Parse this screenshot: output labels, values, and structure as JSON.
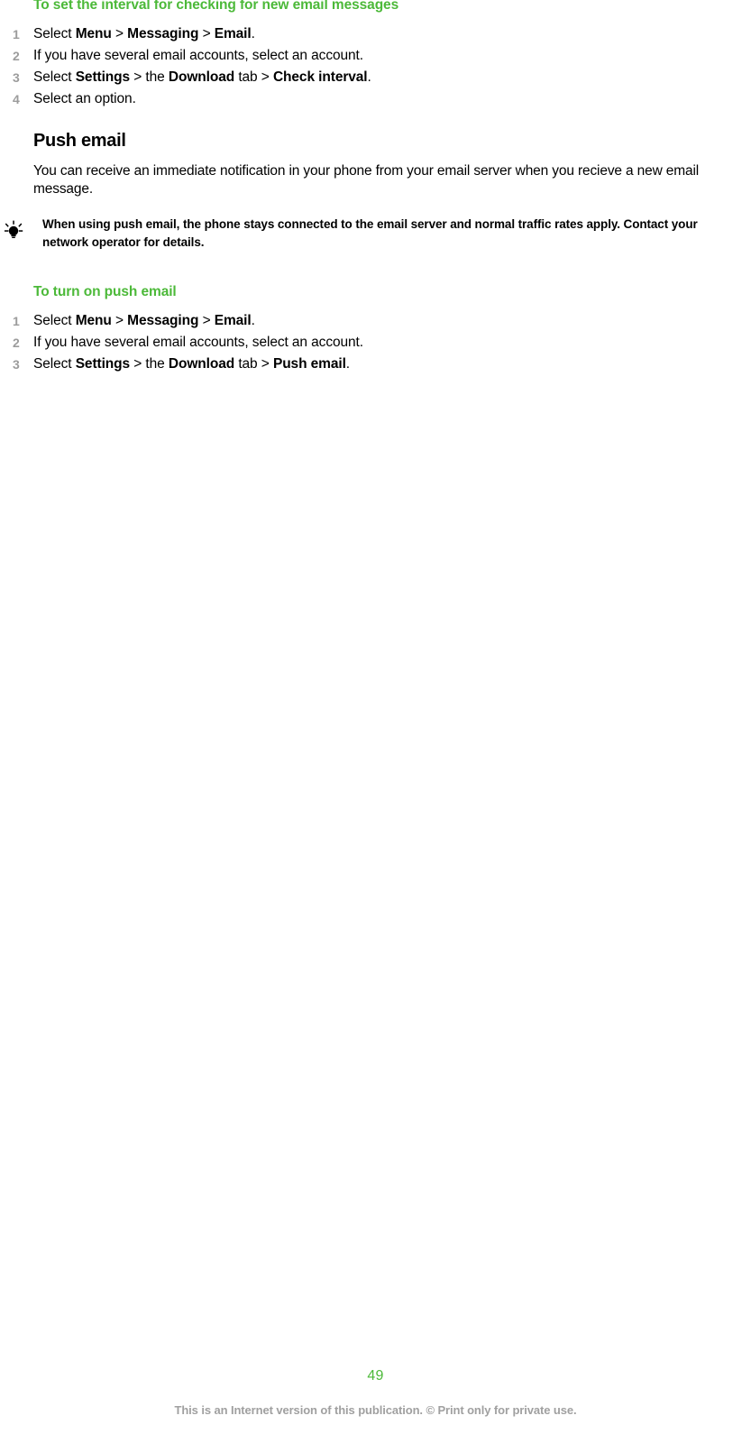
{
  "document": {
    "page_number": "49",
    "footer_note": "This is an Internet version of this publication. © Print only for private use.",
    "accent_color": "#4cb939",
    "step_number_color": "#9c9c9c",
    "footer_color": "#a0a0a0"
  },
  "procedure1": {
    "heading": "To set the interval for checking for new email messages",
    "steps": [
      {
        "num": "1",
        "parts": [
          {
            "text": "Select ",
            "bold": false
          },
          {
            "text": "Menu",
            "bold": true
          },
          {
            "text": " > ",
            "bold": false
          },
          {
            "text": "Messaging",
            "bold": true
          },
          {
            "text": " > ",
            "bold": false
          },
          {
            "text": "Email",
            "bold": true
          },
          {
            "text": ".",
            "bold": false
          }
        ]
      },
      {
        "num": "2",
        "parts": [
          {
            "text": "If you have several email accounts, select an account.",
            "bold": false
          }
        ]
      },
      {
        "num": "3",
        "parts": [
          {
            "text": "Select ",
            "bold": false
          },
          {
            "text": "Settings",
            "bold": true
          },
          {
            "text": " > the ",
            "bold": false
          },
          {
            "text": "Download",
            "bold": true
          },
          {
            "text": " tab > ",
            "bold": false
          },
          {
            "text": "Check interval",
            "bold": true
          },
          {
            "text": ".",
            "bold": false
          }
        ]
      },
      {
        "num": "4",
        "parts": [
          {
            "text": "Select an option.",
            "bold": false
          }
        ]
      }
    ]
  },
  "section": {
    "heading": "Push email",
    "paragraph": "You can receive an immediate notification in your phone from your email server when you recieve a new email message."
  },
  "tip": {
    "icon": "lightbulb-icon",
    "text": "When using push email, the phone stays connected to the email server and normal traffic rates apply. Contact your network operator for details."
  },
  "procedure2": {
    "heading": "To turn on push email",
    "steps": [
      {
        "num": "1",
        "parts": [
          {
            "text": "Select ",
            "bold": false
          },
          {
            "text": "Menu",
            "bold": true
          },
          {
            "text": " > ",
            "bold": false
          },
          {
            "text": "Messaging",
            "bold": true
          },
          {
            "text": " > ",
            "bold": false
          },
          {
            "text": "Email",
            "bold": true
          },
          {
            "text": ".",
            "bold": false
          }
        ]
      },
      {
        "num": "2",
        "parts": [
          {
            "text": "If you have several email accounts, select an account.",
            "bold": false
          }
        ]
      },
      {
        "num": "3",
        "parts": [
          {
            "text": "Select ",
            "bold": false
          },
          {
            "text": "Settings",
            "bold": true
          },
          {
            "text": " > the ",
            "bold": false
          },
          {
            "text": "Download",
            "bold": true
          },
          {
            "text": " tab > ",
            "bold": false
          },
          {
            "text": "Push email",
            "bold": true
          },
          {
            "text": ".",
            "bold": false
          }
        ]
      }
    ]
  }
}
